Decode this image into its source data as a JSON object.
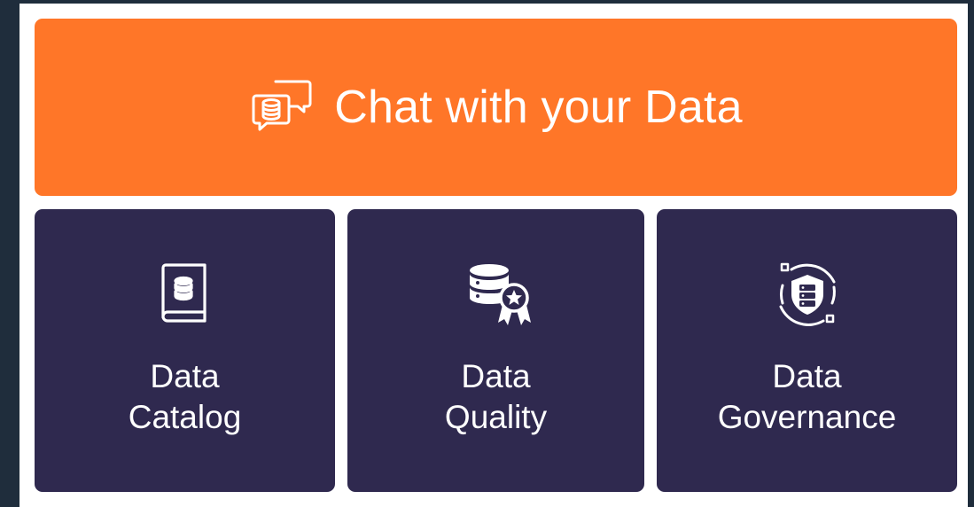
{
  "hero": {
    "title": "Chat with your Data",
    "icon": "chat-database-icon",
    "color": "#ff7628"
  },
  "cards": [
    {
      "line1": "Data",
      "line2": "Catalog",
      "icon": "book-database-icon"
    },
    {
      "line1": "Data",
      "line2": "Quality",
      "icon": "database-award-icon"
    },
    {
      "line1": "Data",
      "line2": "Governance",
      "icon": "shield-server-icon"
    }
  ],
  "colors": {
    "card_background": "#2f294f",
    "page_background": "#1f2d3c",
    "panel_background": "#ffffff",
    "text": "#ffffff"
  }
}
